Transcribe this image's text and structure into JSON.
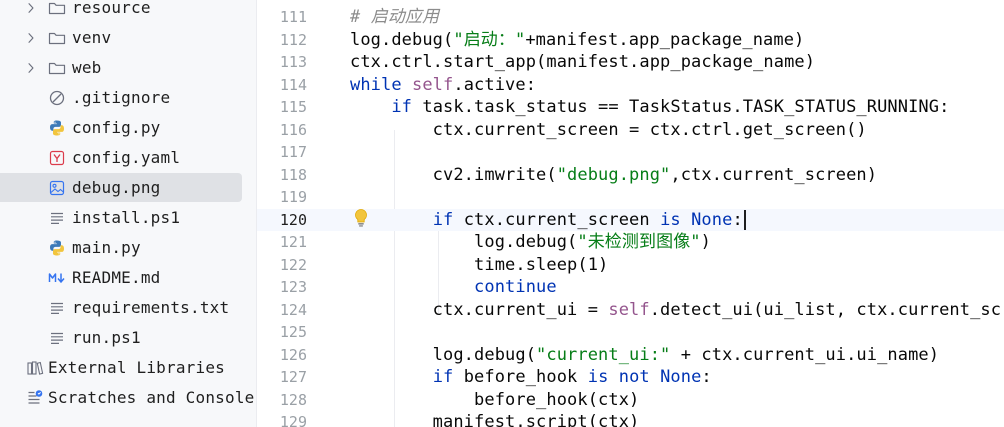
{
  "project_tree": {
    "items": [
      {
        "label": "resource",
        "icon": "folder-icon",
        "expandable": true
      },
      {
        "label": "venv",
        "icon": "folder-icon",
        "expandable": true
      },
      {
        "label": "web",
        "icon": "folder-icon",
        "expandable": true
      },
      {
        "label": ".gitignore",
        "icon": "gitignore-icon",
        "expandable": false
      },
      {
        "label": "config.py",
        "icon": "python-icon",
        "expandable": false
      },
      {
        "label": "config.yaml",
        "icon": "yaml-icon",
        "expandable": false
      },
      {
        "label": "debug.png",
        "icon": "image-icon",
        "expandable": false,
        "selected": true
      },
      {
        "label": "install.ps1",
        "icon": "text-file-icon",
        "expandable": false
      },
      {
        "label": "main.py",
        "icon": "python-icon",
        "expandable": false
      },
      {
        "label": "README.md",
        "icon": "markdown-icon",
        "expandable": false
      },
      {
        "label": "requirements.txt",
        "icon": "text-file-icon",
        "expandable": false
      },
      {
        "label": "run.ps1",
        "icon": "text-file-icon",
        "expandable": false
      },
      {
        "label": "External Libraries",
        "icon": "libraries-icon",
        "expandable": false
      },
      {
        "label": "Scratches and Consoles",
        "icon": "scratches-icon",
        "expandable": false
      }
    ]
  },
  "editor": {
    "current_line": "120",
    "lines": [
      {
        "num": "111",
        "tokens": [
          {
            "t": "# 启动应用",
            "c": "cmt"
          }
        ]
      },
      {
        "num": "112",
        "tokens": [
          {
            "t": "log.debug(",
            "c": ""
          },
          {
            "t": "\"启动：\"",
            "c": "str"
          },
          {
            "t": "+manifest.app_package_name)",
            "c": ""
          }
        ]
      },
      {
        "num": "113",
        "tokens": [
          {
            "t": "ctx.ctrl.start_app(manifest.app_package_name)",
            "c": ""
          }
        ]
      },
      {
        "num": "114",
        "tokens": [
          {
            "t": "while ",
            "c": "kw"
          },
          {
            "t": "self",
            "c": "slf"
          },
          {
            "t": ".active:",
            "c": ""
          }
        ]
      },
      {
        "num": "115",
        "tokens": [
          {
            "t": "    ",
            "c": ""
          },
          {
            "t": "if ",
            "c": "kw"
          },
          {
            "t": "task.task_status == TaskStatus.TASK_STATUS_RUNNING:",
            "c": ""
          }
        ]
      },
      {
        "num": "116",
        "tokens": [
          {
            "t": "        ctx.current_screen = ctx.ctrl.get_screen()",
            "c": ""
          }
        ]
      },
      {
        "num": "117",
        "tokens": []
      },
      {
        "num": "118",
        "tokens": [
          {
            "t": "        cv2.imwrite(",
            "c": ""
          },
          {
            "t": "\"debug.png\"",
            "c": "str"
          },
          {
            "t": ",ctx.current_screen)",
            "c": ""
          }
        ]
      },
      {
        "num": "119",
        "tokens": []
      },
      {
        "num": "120",
        "tokens": [
          {
            "t": "        ",
            "c": ""
          },
          {
            "t": "if ",
            "c": "kw"
          },
          {
            "t": "ctx.current_screen ",
            "c": ""
          },
          {
            "t": "is None",
            "c": "kw"
          },
          {
            "t": ":",
            "c": ""
          }
        ]
      },
      {
        "num": "121",
        "tokens": [
          {
            "t": "            log.debug(",
            "c": ""
          },
          {
            "t": "\"未检测到图像\"",
            "c": "str"
          },
          {
            "t": ")",
            "c": ""
          }
        ]
      },
      {
        "num": "122",
        "tokens": [
          {
            "t": "            time.sleep(1)",
            "c": ""
          }
        ]
      },
      {
        "num": "123",
        "tokens": [
          {
            "t": "            ",
            "c": ""
          },
          {
            "t": "continue",
            "c": "kw"
          }
        ]
      },
      {
        "num": "124",
        "tokens": [
          {
            "t": "        ctx.current_ui = ",
            "c": ""
          },
          {
            "t": "self",
            "c": "slf"
          },
          {
            "t": ".detect_ui(ui_list, ctx.current_screen)",
            "c": ""
          }
        ]
      },
      {
        "num": "125",
        "tokens": []
      },
      {
        "num": "126",
        "tokens": [
          {
            "t": "        log.debug(",
            "c": ""
          },
          {
            "t": "\"current_ui:\"",
            "c": "str"
          },
          {
            "t": " + ctx.current_ui.ui_name)",
            "c": ""
          }
        ]
      },
      {
        "num": "127",
        "tokens": [
          {
            "t": "        ",
            "c": ""
          },
          {
            "t": "if ",
            "c": "kw"
          },
          {
            "t": "before_hook ",
            "c": ""
          },
          {
            "t": "is not None",
            "c": "kw"
          },
          {
            "t": ":",
            "c": ""
          }
        ]
      },
      {
        "num": "128",
        "tokens": [
          {
            "t": "            before_hook(ctx)",
            "c": ""
          }
        ]
      },
      {
        "num": "129",
        "tokens": [
          {
            "t": "        manifest.script(ctx)",
            "c": ""
          }
        ]
      }
    ]
  }
}
